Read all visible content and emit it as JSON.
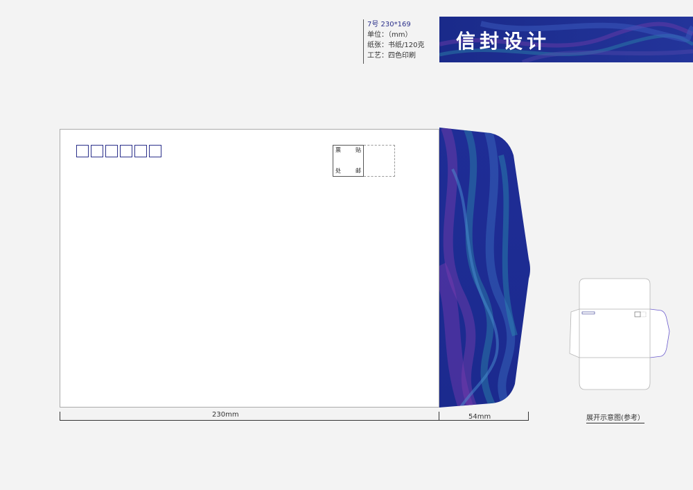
{
  "spec": {
    "size": "7号 230*169",
    "unit": "单位：（mm）",
    "paper": "纸张：书纸/120克",
    "process": "工艺：四色印刷"
  },
  "banner": {
    "title": "信封设计"
  },
  "envelope": {
    "zip_box_count": 6,
    "stamp": {
      "top_left": "票",
      "top_right": "贴",
      "bottom_left": "处",
      "bottom_right": "邮"
    }
  },
  "dimensions": {
    "width_label": "230mm",
    "flap_label": "54mm"
  },
  "preview": {
    "caption": "展开示意图(参考）"
  },
  "colors": {
    "navy": "#1a2a8a",
    "deep_blue": "#1f2d96",
    "purple": "#6a3aa8",
    "teal": "#2a7fa8",
    "zip_border": "#2a2f8a"
  }
}
